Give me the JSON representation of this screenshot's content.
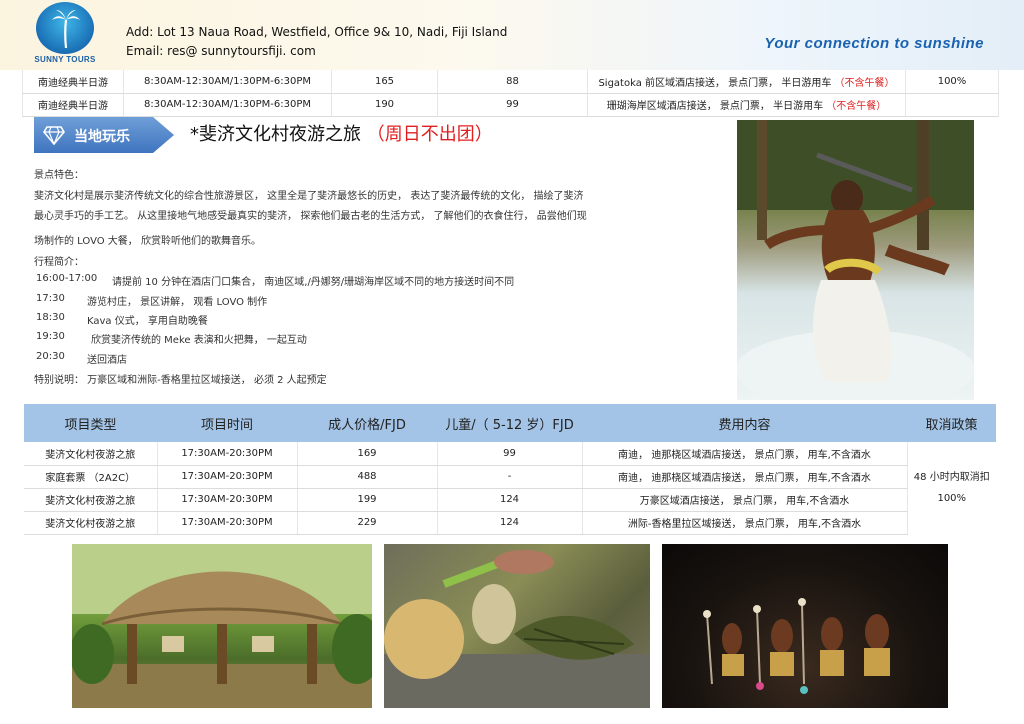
{
  "header": {
    "logo_text": "SUNNY TOURS",
    "address": "Add:  Lot 13  Naua Road,  Westfield,  Office 9& 10,  Nadi, Fiji Island",
    "email": "Email:   res@ sunnytoursfiji. com",
    "slogan": "Your  connection  to  sunshine"
  },
  "top_table": {
    "rows": [
      {
        "type": "南迪经典半日游",
        "time": "8:30AM-12:30AM/1:30PM-6:30PM",
        "adult": "165",
        "child": "88",
        "fee_main": "Sigatoka 前区域酒店接送，   景点门票，   半日游用车 ",
        "fee_note": "（不含午餐）",
        "policy": "100%"
      },
      {
        "type": "南迪经典半日游",
        "time": "8:30AM-12:30AM/1:30PM-6:30PM",
        "adult": "190",
        "child": "99",
        "fee_main": "珊瑚海岸区域酒店接送，   景点门票，   半日游用车 ",
        "fee_note": "（不含午餐）",
        "policy": ""
      }
    ]
  },
  "section": {
    "badge_label": "当地玩乐",
    "title_main": "*斐济文化村夜游之旅  ",
    "title_note": "（周日不出团）"
  },
  "description": {
    "feature_heading": "景点特色：",
    "lines": [
      "斐济文化村是展示斐济传统文化的综合性旅游景区，   这里全是了斐济最悠长的历史，   表达了斐济最传统的文化，   描绘了斐济",
      "最心灵手巧的手工艺。   从这里接地气地感受最真实的斐济，   探索他们最古老的生活方式，   了解他们的衣食住行，   品尝他们现",
      "场制作的 LOVO 大餐，   欣赏聆听他们的歌舞音乐。"
    ],
    "itinerary_heading": "行程简介：",
    "itinerary": [
      {
        "time": "16:00-17:00",
        "desc": "请提前 10 分钟在酒店门口集合，   南迪区域,/丹娜努/珊瑚海岸区域不同的地方接送时间不同"
      },
      {
        "time": "17:30",
        "desc": "游览村庄，   景区讲解，   观看 LOVO 制作"
      },
      {
        "time": "18:30",
        "desc": "Kava 仪式，   享用自助晚餐"
      },
      {
        "time": "19:30",
        "desc": "欣赏斐济传统的 Meke 表演和火把舞，   一起互动"
      },
      {
        "time": "20:30",
        "desc": "送回酒店"
      }
    ],
    "special_note": "特别说明：   万豪区域和洲际-香格里拉区域接送，   必须 2 人起预定"
  },
  "price_table": {
    "headers": [
      "项目类型",
      "项目时间",
      "成人价格/FJD",
      "儿童/（ 5-12 岁）FJD",
      "费用内容",
      "取消政策"
    ],
    "rows": [
      {
        "type": "斐济文化村夜游之旅",
        "time": "17:30AM-20:30PM",
        "adult": "169",
        "child": "99",
        "fee": "南迪，   迪那桡区域酒店接送，   景点门票，   用车,不含酒水"
      },
      {
        "type": "家庭套票  （2A2C）",
        "time": "17:30AM-20:30PM",
        "adult": "488",
        "child": "-",
        "fee": "南迪，   迪那桡区域酒店接送，   景点门票，   用车,不含酒水"
      },
      {
        "type": "斐济文化村夜游之旅",
        "time": "17:30AM-20:30PM",
        "adult": "199",
        "child": "124",
        "fee": "万豪区域酒店接送，   景点门票，   用车,不含酒水"
      },
      {
        "type": "斐济文化村夜游之旅",
        "time": "17:30AM-20:30PM",
        "adult": "229",
        "child": "124",
        "fee": "洲际-香格里拉区域接送，   景点门票，   用车,不含酒水"
      }
    ],
    "policy_line1": "48 小时内取消扣",
    "policy_line2": "100%"
  },
  "colors": {
    "accent_blue": "#3f74bf",
    "table_header": "#a3c4e6",
    "slogan_blue": "#1a62b0",
    "note_red": "#e02020"
  }
}
